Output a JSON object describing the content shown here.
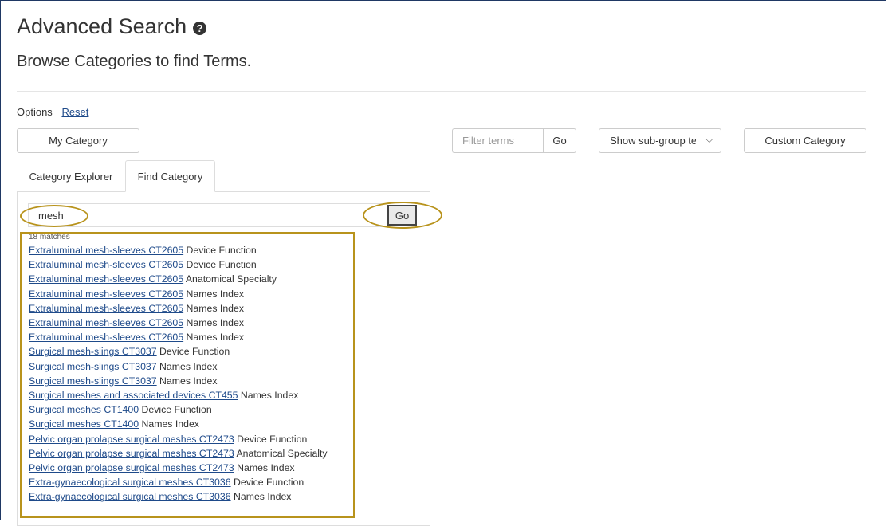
{
  "header": {
    "title": "Advanced Search",
    "help_icon": "question-circle-icon",
    "subtitle": "Browse Categories to find Terms."
  },
  "options": {
    "label": "Options",
    "reset_label": "Reset"
  },
  "toolbar": {
    "my_category": "My Category",
    "filter_placeholder": "Filter terms",
    "filter_go": "Go",
    "subgroup_value": "Show sub-group terms",
    "custom_category": "Custom Category"
  },
  "tabs": [
    {
      "label": "Category Explorer",
      "active": false
    },
    {
      "label": "Find Category",
      "active": true
    }
  ],
  "find": {
    "query": "mesh",
    "go_label": "Go",
    "matches_label": "18 matches"
  },
  "results": [
    {
      "link": "Extraluminal mesh-sleeves CT2605",
      "type": "Device Function"
    },
    {
      "link": "Extraluminal mesh-sleeves CT2605",
      "type": "Device Function"
    },
    {
      "link": "Extraluminal mesh-sleeves CT2605",
      "type": "Anatomical Specialty"
    },
    {
      "link": "Extraluminal mesh-sleeves CT2605",
      "type": "Names Index"
    },
    {
      "link": "Extraluminal mesh-sleeves CT2605",
      "type": "Names Index"
    },
    {
      "link": "Extraluminal mesh-sleeves CT2605",
      "type": "Names Index"
    },
    {
      "link": "Extraluminal mesh-sleeves CT2605",
      "type": "Names Index"
    },
    {
      "link": "Surgical mesh-slings CT3037",
      "type": "Device Function"
    },
    {
      "link": "Surgical mesh-slings CT3037",
      "type": "Names Index"
    },
    {
      "link": "Surgical mesh-slings CT3037",
      "type": "Names Index"
    },
    {
      "link": "Surgical meshes and associated devices CT455",
      "type": "Names Index"
    },
    {
      "link": "Surgical meshes CT1400",
      "type": "Device Function"
    },
    {
      "link": "Surgical meshes CT1400",
      "type": "Names Index"
    },
    {
      "link": "Pelvic organ prolapse surgical meshes CT2473",
      "type": "Device Function"
    },
    {
      "link": "Pelvic organ prolapse surgical meshes CT2473",
      "type": "Anatomical Specialty"
    },
    {
      "link": "Pelvic organ prolapse surgical meshes CT2473",
      "type": "Names Index"
    },
    {
      "link": "Extra-gynaecological surgical meshes CT3036",
      "type": "Device Function"
    },
    {
      "link": "Extra-gynaecological surgical meshes CT3036",
      "type": "Names Index"
    }
  ],
  "colors": {
    "link": "#1e4a8a",
    "highlight": "#b8931c",
    "frame": "#1f3864"
  }
}
